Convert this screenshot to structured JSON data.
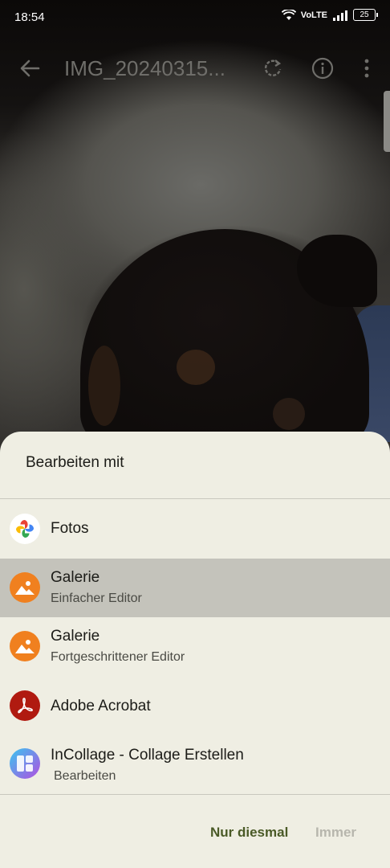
{
  "status_bar": {
    "time": "18:54",
    "network": "VoLTE",
    "battery": "25"
  },
  "toolbar": {
    "title": "IMG_20240315...",
    "icons": [
      "back-arrow-icon",
      "rotate-icon",
      "info-icon",
      "more-vert-icon"
    ]
  },
  "dialog": {
    "title": "Bearbeiten mit",
    "apps": [
      {
        "label": "Fotos",
        "subtitle": "",
        "icon": "google-photos-icon"
      },
      {
        "label": "Galerie",
        "subtitle": "Einfacher Editor",
        "icon": "gallery-icon",
        "selected": true
      },
      {
        "label": "Galerie",
        "subtitle": "Fortgeschrittener Editor",
        "icon": "gallery-icon"
      },
      {
        "label": "Adobe Acrobat",
        "subtitle": "",
        "icon": "adobe-acrobat-icon"
      },
      {
        "label": "InCollage - Collage Erstellen",
        "subtitle": "Bearbeiten",
        "icon": "incollage-icon"
      }
    ],
    "buttons": {
      "just_once": "Nur diesmal",
      "always": "Immer"
    }
  },
  "colors": {
    "sheet_background": "#efeee3",
    "selected_row": "#c4c3bb",
    "accent_button": "#4a5a27",
    "disabled_button": "#b7b6ad",
    "gallery_orange": "#f0801f",
    "acrobat_red": "#b01a10"
  }
}
